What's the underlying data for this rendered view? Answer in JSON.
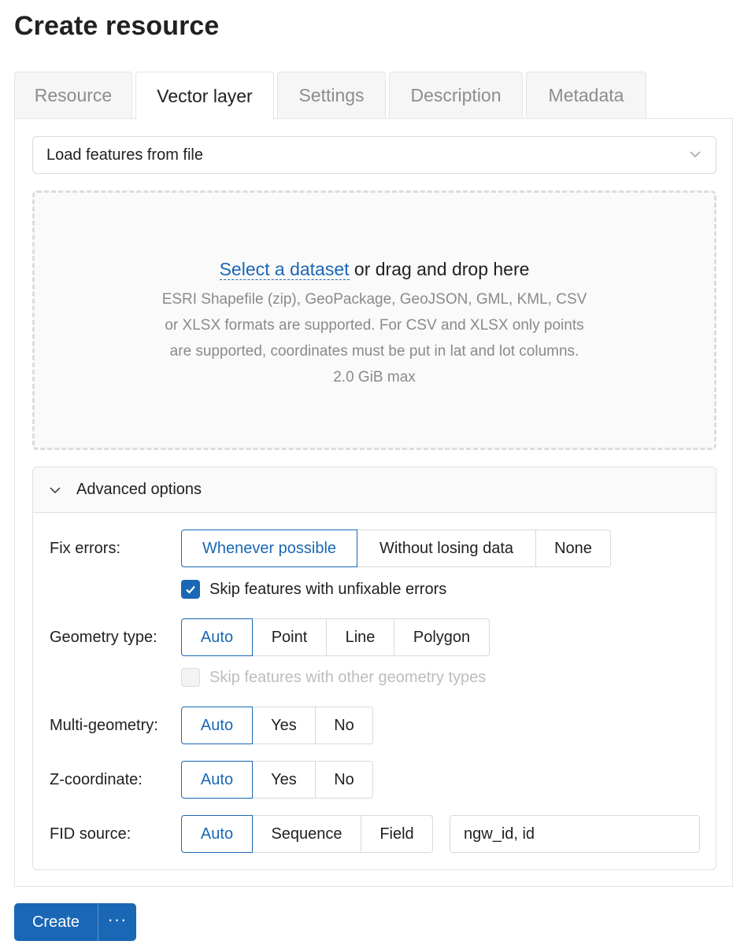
{
  "page": {
    "title": "Create resource"
  },
  "tabs": [
    {
      "label": "Resource",
      "active": false
    },
    {
      "label": "Vector layer",
      "active": true
    },
    {
      "label": "Settings",
      "active": false
    },
    {
      "label": "Description",
      "active": false
    },
    {
      "label": "Metadata",
      "active": false
    }
  ],
  "source_select": {
    "value": "Load features from file",
    "icon": "chevron-down-icon"
  },
  "dropzone": {
    "link": "Select a dataset",
    "rest": " or drag and drop here",
    "info_lines": [
      "ESRI Shapefile (zip), GeoPackage, GeoJSON, GML, KML, CSV",
      "or XLSX formats are supported. For CSV and XLSX only points",
      "are supported, coordinates must be put in lat and lot columns.",
      "2.0 GiB max"
    ]
  },
  "advanced": {
    "title": "Advanced options",
    "icon": "chevron-down-icon",
    "fix_errors": {
      "label": "Fix errors:",
      "options": [
        "Whenever possible",
        "Without losing data",
        "None"
      ],
      "selected": "Whenever possible"
    },
    "skip_unfixable": {
      "label": "Skip features with unfixable errors",
      "checked": true
    },
    "geometry_type": {
      "label": "Geometry type:",
      "options": [
        "Auto",
        "Point",
        "Line",
        "Polygon"
      ],
      "selected": "Auto"
    },
    "skip_other_geom": {
      "label": "Skip features with other geometry types",
      "checked": false,
      "disabled": true
    },
    "multi_geometry": {
      "label": "Multi-geometry:",
      "options": [
        "Auto",
        "Yes",
        "No"
      ],
      "selected": "Auto"
    },
    "z_coordinate": {
      "label": "Z-coordinate:",
      "options": [
        "Auto",
        "Yes",
        "No"
      ],
      "selected": "Auto"
    },
    "fid_source": {
      "label": "FID source:",
      "options": [
        "Auto",
        "Sequence",
        "Field"
      ],
      "selected": "Auto",
      "field_value": "ngw_id, id"
    }
  },
  "footer": {
    "create_label": "Create",
    "more_label": "···"
  },
  "colors": {
    "accent": "#1a67b5",
    "border": "#d9d9d9",
    "muted_text": "#8a8a8a"
  }
}
